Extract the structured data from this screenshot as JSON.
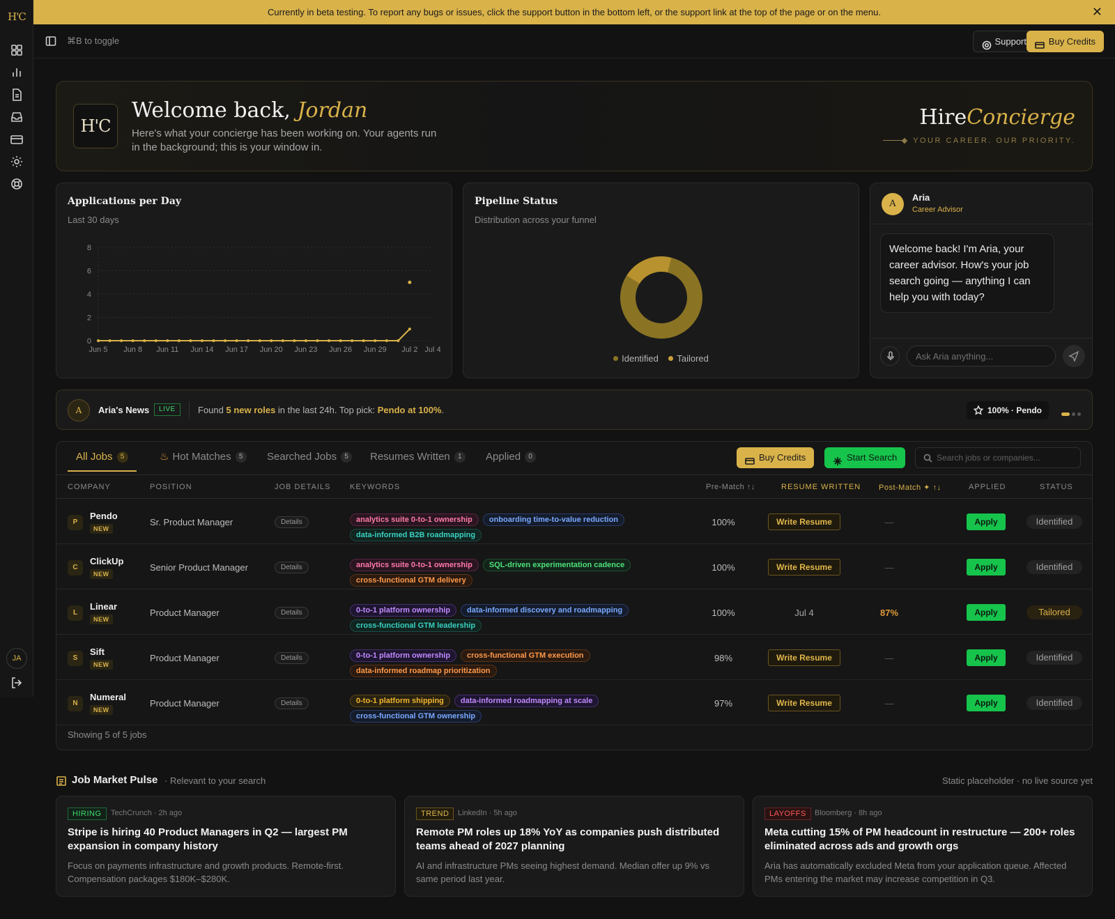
{
  "banner": {
    "text": "Currently in beta testing. To report any bugs or issues, click the support button in the bottom left, or the support link at the top of the page or on the menu.",
    "close": "✕"
  },
  "sidebar": {
    "logo": "H'C",
    "items": [
      "grid-icon",
      "bar-chart-icon",
      "document-icon",
      "inbox-icon",
      "credit-card-icon",
      "gear-icon",
      "lifebuoy-icon"
    ],
    "avatar": "JA"
  },
  "topbar": {
    "toggle_hint": "⌘B to toggle",
    "support": "Support",
    "buy_credits": "Buy Credits"
  },
  "hero": {
    "logo": "H'C",
    "greeting": "Welcome back, ",
    "name": "Jordan",
    "subtitle": "Here's what your concierge has been working on. Your agents run in the background; this is your window in.",
    "brand_a": "Hire",
    "brand_b": "Concierge",
    "tagline": "◆ YOUR CAREER. OUR PRIORITY."
  },
  "applications_card": {
    "title": "Applications per Day",
    "subtitle": "Last 30 days"
  },
  "chart_data": {
    "type": "line",
    "title": "Applications per Day",
    "subtitle": "Last 30 days",
    "x_tick_labels": [
      "Jun 5",
      "Jun 8",
      "Jun 11",
      "Jun 14",
      "Jun 17",
      "Jun 20",
      "Jun 23",
      "Jun 26",
      "Jun 29",
      "Jul 2",
      "Jul 4"
    ],
    "y_ticks": [
      0,
      2,
      4,
      6,
      8
    ],
    "ylim": [
      0,
      8
    ],
    "x": [
      "Jun 5",
      "Jun 6",
      "Jun 7",
      "Jun 8",
      "Jun 9",
      "Jun 10",
      "Jun 11",
      "Jun 12",
      "Jun 13",
      "Jun 14",
      "Jun 15",
      "Jun 16",
      "Jun 17",
      "Jun 18",
      "Jun 19",
      "Jun 20",
      "Jun 21",
      "Jun 22",
      "Jun 23",
      "Jun 24",
      "Jun 25",
      "Jun 26",
      "Jun 27",
      "Jun 28",
      "Jun 29",
      "Jun 30",
      "Jul 1",
      "Jul 2",
      "Jul 3",
      "Jul 4"
    ],
    "values": [
      0,
      0,
      0,
      0,
      0,
      0,
      0,
      0,
      0,
      0,
      0,
      0,
      0,
      0,
      0,
      0,
      0,
      0,
      0,
      0,
      0,
      0,
      0,
      0,
      0,
      0,
      0,
      1,
      null,
      null
    ],
    "highlight_point": {
      "x": "Jul 2",
      "y": 5
    },
    "grid": true,
    "color": "#d9b24a"
  },
  "pipeline_card": {
    "title": "Pipeline Status",
    "subtitle": "Distribution across your funnel",
    "chart_data": {
      "type": "pie",
      "labels": [
        "Identified",
        "Tailored"
      ],
      "values": [
        4,
        1
      ],
      "colors": [
        "#8a7424",
        "#b8922e"
      ]
    },
    "legend": [
      {
        "label": "Identified",
        "color": "#8a7424"
      },
      {
        "label": "Tailored",
        "color": "#c9a03a"
      }
    ]
  },
  "aria": {
    "avatar": "A",
    "name": "Aria",
    "role": "Career Advisor",
    "message": "Welcome back! I'm Aria, your career advisor. How's your job search going — anything I can help you with today?",
    "input_placeholder": "Ask Aria anything..."
  },
  "news": {
    "avatar": "A",
    "title": "Aria's News",
    "live": "LIVE",
    "text_a": "Found ",
    "text_b": "5 new roles",
    "text_c": " in the last 24h. Top pick: ",
    "text_d": "Pendo at 100%",
    "text_e": ".",
    "pill": "100% · Pendo"
  },
  "jobs": {
    "tabs": [
      {
        "label": "All Jobs",
        "count": "5"
      },
      {
        "label": "Hot Matches",
        "count": "5"
      },
      {
        "label": "Searched Jobs",
        "count": "5"
      },
      {
        "label": "Resumes Written",
        "count": "1"
      },
      {
        "label": "Applied",
        "count": "0"
      }
    ],
    "buy_credits": "Buy Credits",
    "start_search": "Start Search",
    "search_placeholder": "Search jobs or companies...",
    "columns": {
      "company": "COMPANY",
      "position": "POSITION",
      "details": "JOB DETAILS",
      "keywords": "KEYWORDS",
      "prematch": "Pre-Match ↑↓",
      "resume": "RESUME WRITTEN",
      "postmatch": "Post-Match ✦ ↑↓",
      "applied": "APPLIED",
      "status": "STATUS"
    },
    "rows": [
      {
        "initial": "P",
        "company": "Pendo",
        "badge": "NEW",
        "position": "Sr. Product Manager",
        "details": "Details",
        "keywords": [
          {
            "t": "analytics suite 0-to-1 ownership",
            "c": "pink"
          },
          {
            "t": "onboarding time-to-value reduction",
            "c": "blue"
          },
          {
            "t": "data-informed B2B roadmapping",
            "c": "teal"
          }
        ],
        "prematch": "100%",
        "resume": "Write Resume",
        "post": "—",
        "apply": "Apply",
        "status": "Identified"
      },
      {
        "initial": "C",
        "company": "ClickUp",
        "badge": "NEW",
        "position": "Senior Product Manager",
        "details": "Details",
        "keywords": [
          {
            "t": "analytics suite 0-to-1 ownership",
            "c": "pink"
          },
          {
            "t": "SQL-driven experimentation cadence",
            "c": "green"
          },
          {
            "t": "cross-functional GTM delivery",
            "c": "orange"
          }
        ],
        "prematch": "100%",
        "resume": "Write Resume",
        "post": "—",
        "apply": "Apply",
        "status": "Identified"
      },
      {
        "initial": "L",
        "company": "Linear",
        "badge": "NEW",
        "position": "Product Manager",
        "details": "Details",
        "keywords": [
          {
            "t": "0-to-1 platform ownership",
            "c": "purple"
          },
          {
            "t": "data-informed discovery and roadmapping",
            "c": "blue"
          },
          {
            "t": "cross-functional GTM leadership",
            "c": "teal"
          }
        ],
        "prematch": "100%",
        "resume_date": "Jul 4",
        "post": "87%",
        "apply": "Apply",
        "status": "Tailored"
      },
      {
        "initial": "S",
        "company": "Sift",
        "badge": "NEW",
        "position": "Product Manager",
        "details": "Details",
        "keywords": [
          {
            "t": "0-to-1 platform ownership",
            "c": "purple"
          },
          {
            "t": "cross-functional GTM execution",
            "c": "orange"
          },
          {
            "t": "data-informed roadmap prioritization",
            "c": "orange"
          }
        ],
        "prematch": "98%",
        "resume": "Write Resume",
        "post": "—",
        "apply": "Apply",
        "status": "Identified"
      },
      {
        "initial": "N",
        "company": "Numeral",
        "badge": "NEW",
        "position": "Product Manager",
        "details": "Details",
        "keywords": [
          {
            "t": "0-to-1 platform shipping",
            "c": "amber"
          },
          {
            "t": "data-informed roadmapping at scale",
            "c": "purple"
          },
          {
            "t": "cross-functional GTM ownership",
            "c": "blue"
          }
        ],
        "prematch": "97%",
        "resume": "Write Resume",
        "post": "—",
        "apply": "Apply",
        "status": "Identified"
      }
    ],
    "showing": "Showing 5 of 5 jobs"
  },
  "pulse": {
    "title": "Job Market Pulse",
    "subtitle": "· Relevant to your search",
    "note": "Static placeholder · no live source yet",
    "cards": [
      {
        "tag": "HIRING",
        "tag_type": "hiring",
        "source": "TechCrunch · 2h ago",
        "headline": "Stripe is hiring 40 Product Managers in Q2 — largest PM expansion in company history",
        "body": "Focus on payments infrastructure and growth products. Remote-first. Compensation packages $180K–$280K."
      },
      {
        "tag": "TREND",
        "tag_type": "trend",
        "source": "LinkedIn · 5h ago",
        "headline": "Remote PM roles up 18% YoY as companies push distributed teams ahead of 2027 planning",
        "body": "AI and infrastructure PMs seeing highest demand. Median offer up 9% vs same period last year."
      },
      {
        "tag": "LAYOFFS",
        "tag_type": "layoffs",
        "source": "Bloomberg · 8h ago",
        "headline": "Meta cutting 15% of PM headcount in restructure — 200+ roles eliminated across ads and growth orgs",
        "body": "Aria has automatically excluded Meta from your application queue. Affected PMs entering the market may increase competition in Q3."
      }
    ]
  }
}
